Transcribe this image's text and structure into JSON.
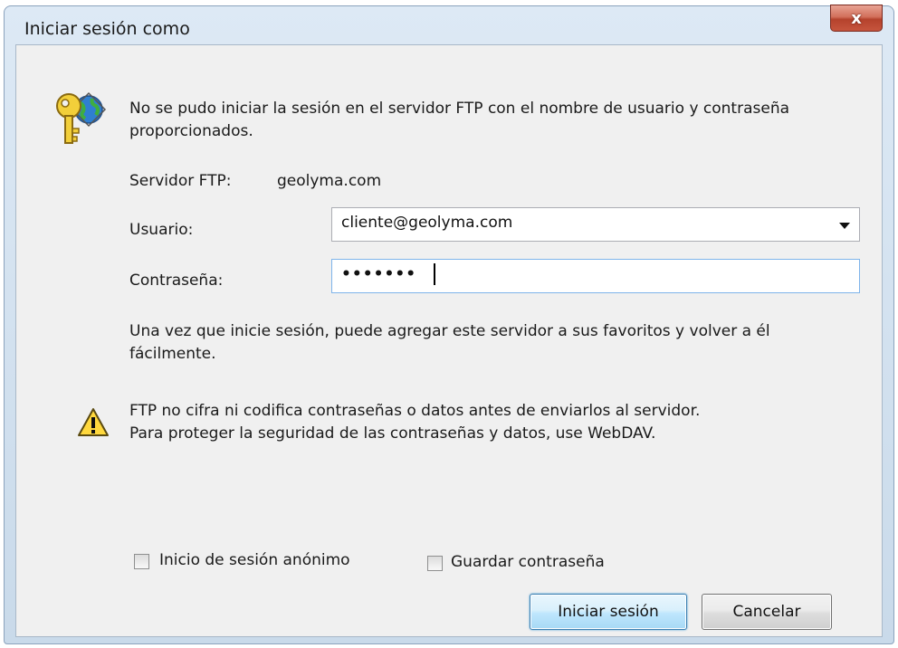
{
  "window": {
    "title": "Iniciar sesión como",
    "close_label": "x"
  },
  "message": {
    "line1": "No se pudo iniciar la sesión en el servidor FTP con el nombre de usuario y contraseña",
    "line2": "proporcionados."
  },
  "server": {
    "label": "Servidor FTP:",
    "value": "geolyma.com"
  },
  "user": {
    "label": "Usuario:",
    "value": "cliente@geolyma.com"
  },
  "password": {
    "label": "Contraseña:",
    "masked_value": "•••••••"
  },
  "info": {
    "line1": "Una vez que inicie sesión, puede agregar este servidor a sus favoritos y volver a él",
    "line2": "fácilmente."
  },
  "warning": {
    "line1": "FTP no cifra ni codifica contraseñas o datos antes de enviarlos al servidor.",
    "line2": "Para proteger la seguridad de las contraseñas y datos, use WebDAV."
  },
  "options": {
    "anonymous_label": "Inicio de sesión anónimo",
    "anonymous_checked": false,
    "save_password_label": "Guardar contraseña",
    "save_password_checked": false
  },
  "buttons": {
    "login": "Iniciar sesión",
    "cancel": "Cancelar"
  },
  "icons": {
    "dialog": "key-globe-icon",
    "warning": "warning-icon"
  },
  "colors": {
    "focus_border": "#7eb4ea",
    "primary_button_border": "#3c7fb1",
    "close_button": "#c6553e"
  }
}
